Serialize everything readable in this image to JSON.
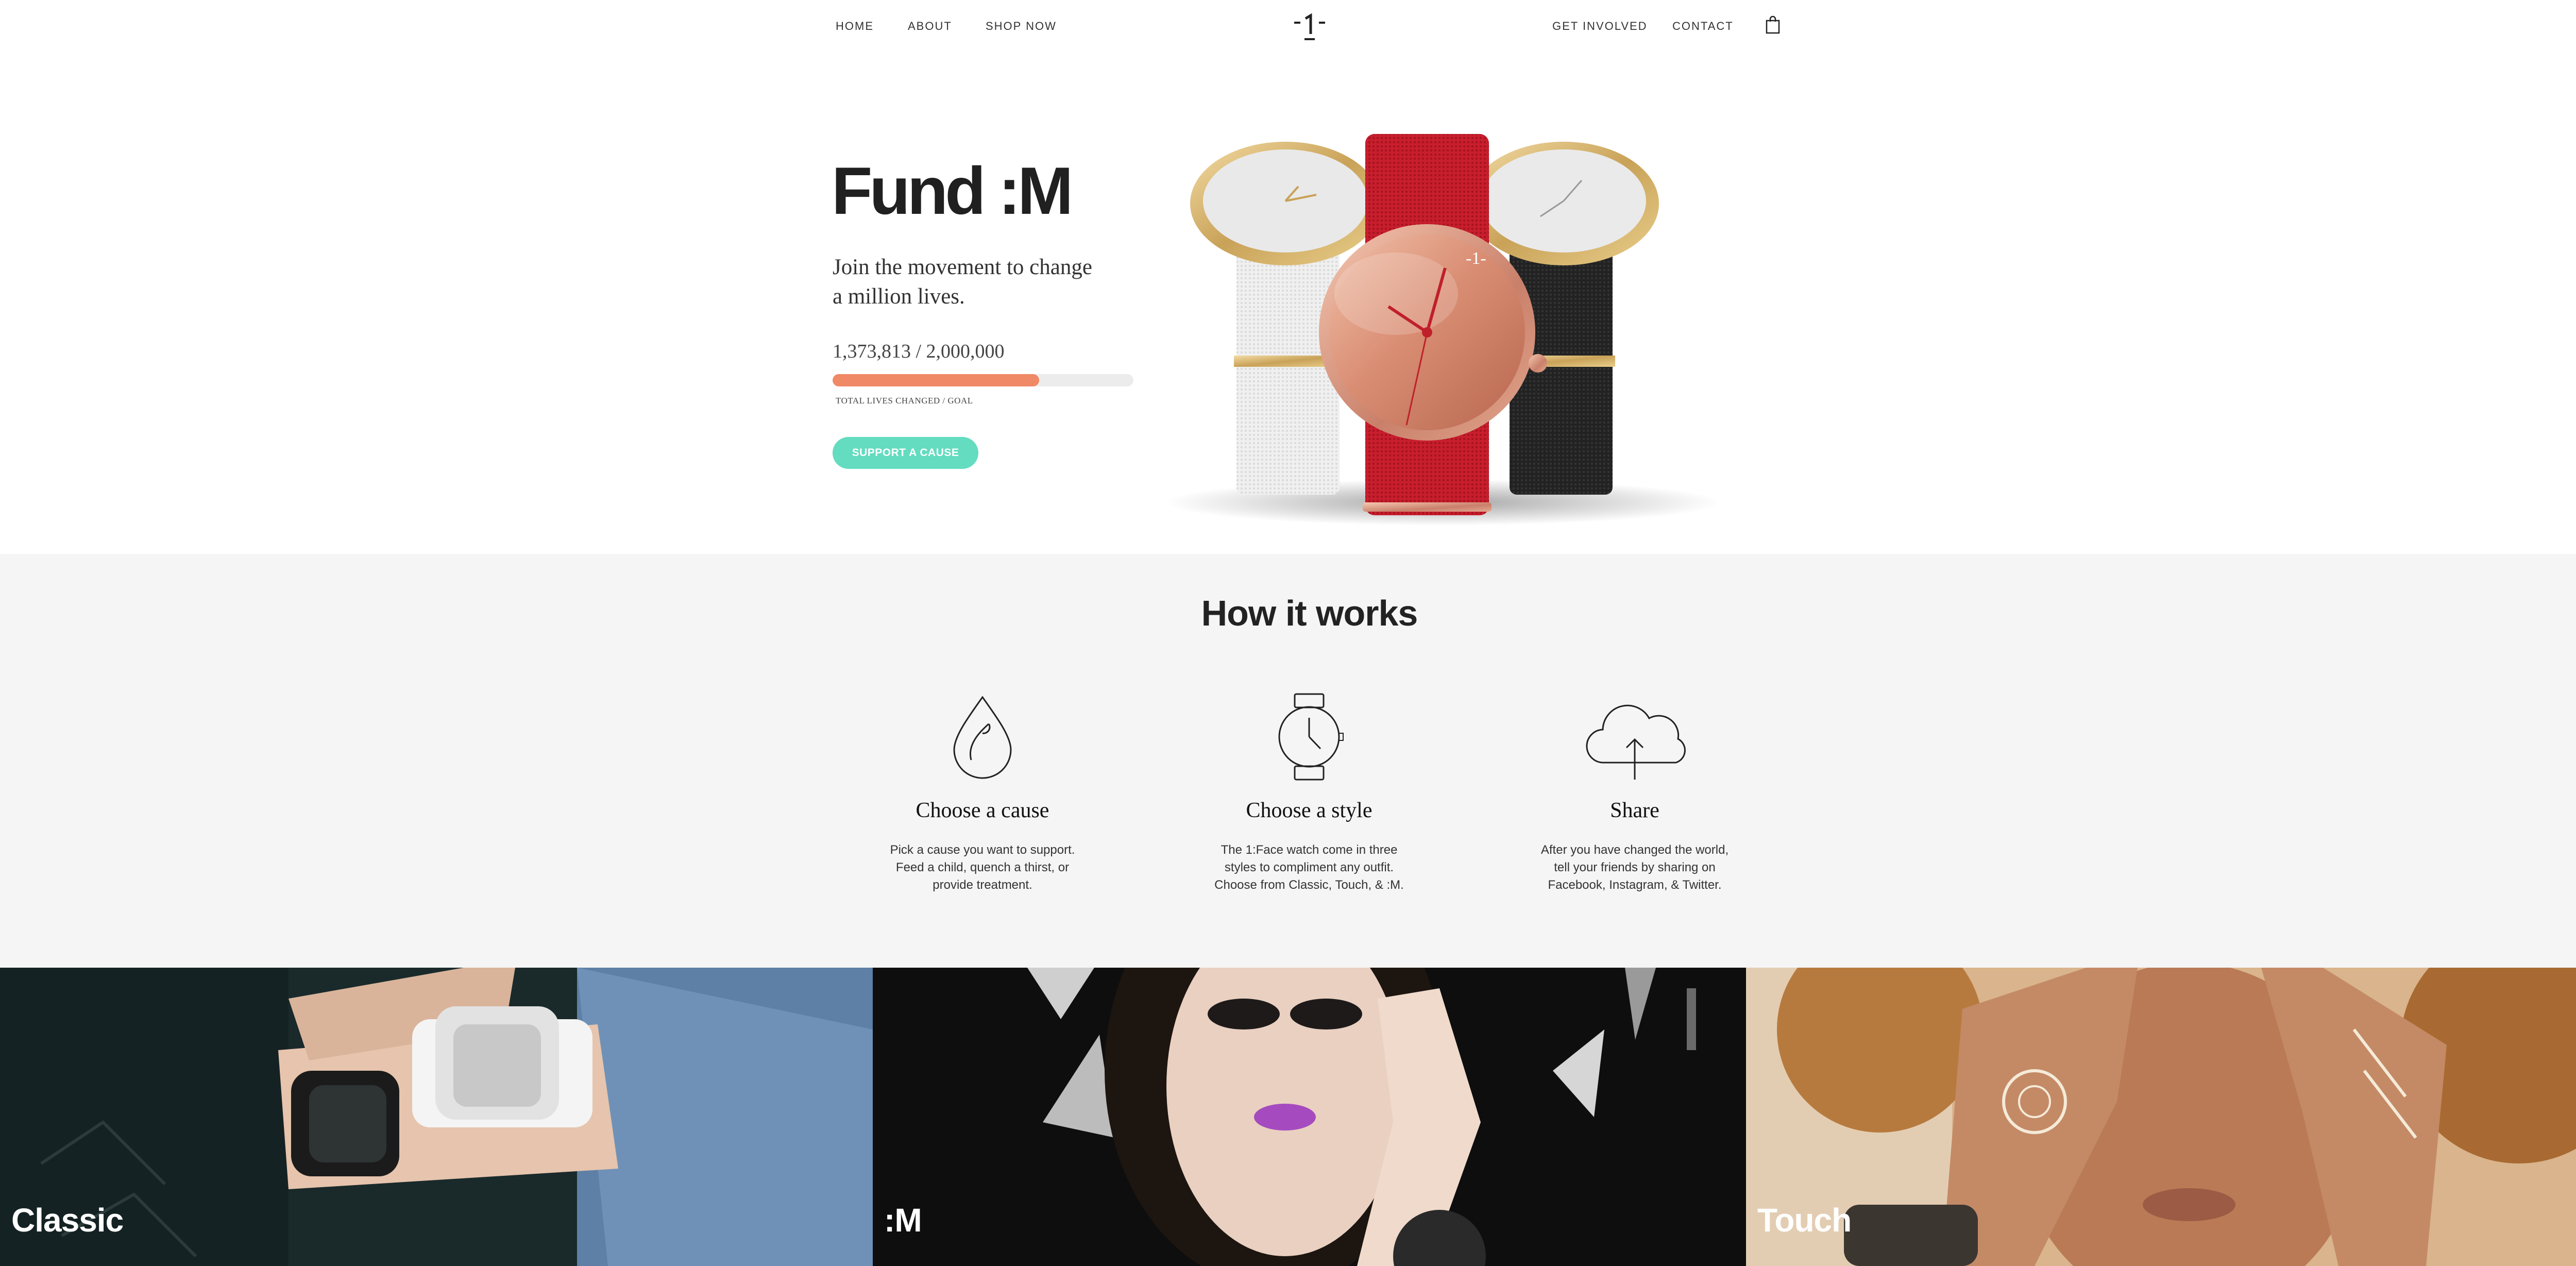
{
  "nav": {
    "left": [
      "HOME",
      "ABOUT",
      "SHOP NOW"
    ],
    "right": [
      "GET INVOLVED",
      "CONTACT"
    ],
    "logo": "-1-",
    "cart_icon": "shopping-bag-icon"
  },
  "hero": {
    "title": "Fund :M",
    "subtitle_line1": "Join the movement to change",
    "subtitle_line2": "a million lives.",
    "count": "1,373,813 / 2,000,000",
    "progress_fraction": 0.687,
    "progress_label": "TOTAL LIVES CHANGED / GOAL",
    "button": "SUPPORT A CAUSE",
    "progress_color": "#f08966",
    "button_color": "#63dcc0"
  },
  "how": {
    "title": "How it works",
    "steps": [
      {
        "icon": "droplet-icon",
        "title": "Choose a cause",
        "text": "Pick a cause you want to support. Feed a child, quench a thirst, or provide treatment."
      },
      {
        "icon": "watch-icon",
        "title": "Choose a style",
        "text": "The 1:Face watch come in three styles to compliment any outfit. Choose from Classic, Touch, & :M."
      },
      {
        "icon": "cloud-upload-icon",
        "title": "Share",
        "text": "After you have changed the world, tell your friends by sharing on Facebook, Instagram, & Twitter."
      }
    ]
  },
  "gallery": [
    {
      "label": "Classic"
    },
    {
      "label": ":M"
    },
    {
      "label": "Touch"
    }
  ]
}
